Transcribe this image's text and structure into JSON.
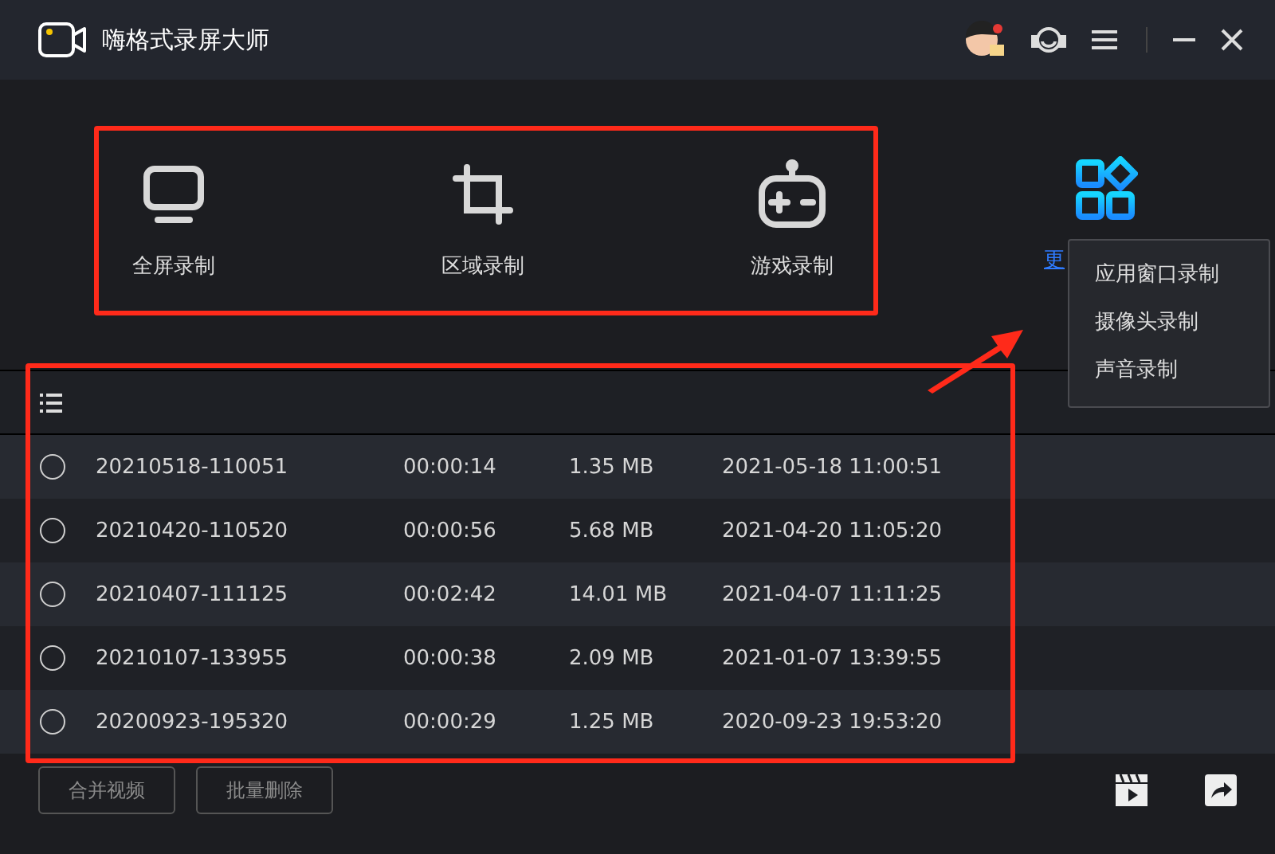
{
  "window": {
    "title": "嗨格式录屏大师"
  },
  "modes": [
    {
      "label": "全屏录制",
      "kind": "monitor"
    },
    {
      "label": "区域录制",
      "kind": "crop"
    },
    {
      "label": "游戏录制",
      "kind": "gamepad"
    }
  ],
  "more": {
    "label": "更"
  },
  "more_menu": [
    "应用窗口录制",
    "摄像头录制",
    "声音录制"
  ],
  "recordings": [
    {
      "name": "20210518-110051",
      "duration": "00:00:14",
      "size": "1.35 MB",
      "date": "2021-05-18 11:00:51",
      "selected": false
    },
    {
      "name": "20210420-110520",
      "duration": "00:00:56",
      "size": "5.68 MB",
      "date": "2021-04-20 11:05:20",
      "selected": false
    },
    {
      "name": "20210407-111125",
      "duration": "00:02:42",
      "size": "14.01 MB",
      "date": "2021-04-07 11:11:25",
      "selected": false
    },
    {
      "name": "20210107-133955",
      "duration": "00:00:38",
      "size": "2.09 MB",
      "date": "2021-01-07 13:39:55",
      "selected": false
    },
    {
      "name": "20200923-195320",
      "duration": "00:00:29",
      "size": "1.25 MB",
      "date": "2020-09-23 19:53:20",
      "selected": false
    }
  ],
  "buttons": [
    "合并视频",
    "批量删除"
  ]
}
